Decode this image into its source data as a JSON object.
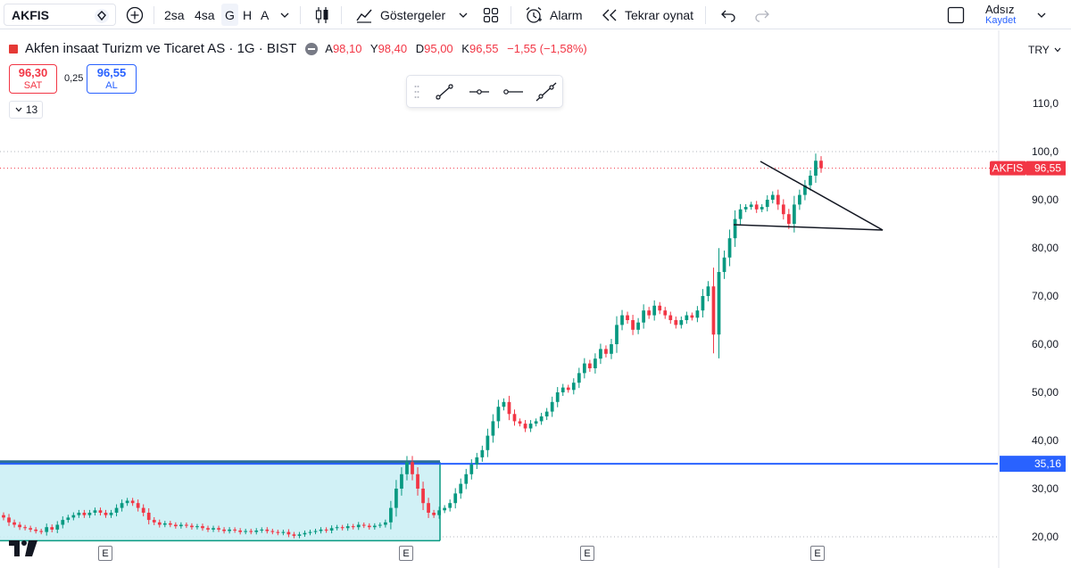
{
  "toolbar": {
    "symbol": "AKFIS",
    "timeframes": [
      "2sa",
      "4sa",
      "G",
      "H",
      "A"
    ],
    "active_timeframe": "G",
    "indicators_label": "Göstergeler",
    "alarm_label": "Alarm",
    "replay_label": "Tekrar oynat",
    "user_name": "Adsız",
    "save_label": "Kaydet"
  },
  "legend": {
    "title": "Akfen insaat Turizm ve Ticaret AS · 1G · BIST",
    "open_label": "A",
    "open": "98,10",
    "high_label": "Y",
    "high": "98,40",
    "low_label": "D",
    "low": "95,00",
    "close_label": "K",
    "close": "96,55",
    "change": "−1,55 (−1,58%)"
  },
  "trade": {
    "sell_price": "96,30",
    "sell_label": "SAT",
    "spread": "0,25",
    "buy_price": "96,55",
    "buy_label": "AL",
    "collapse_count": "13"
  },
  "currency": "TRY",
  "colors": {
    "up": "#089981",
    "down": "#f23645",
    "line": "#2962ff",
    "zone": "#c9eef4"
  },
  "chart_data": {
    "type": "candlestick",
    "price_scale": [
      "110,0",
      "100,0",
      "90,00",
      "80,00",
      "70,00",
      "60,00",
      "50,00",
      "40,00",
      "30,00",
      "20,00"
    ],
    "price_scale_values": [
      110,
      100,
      90,
      80,
      70,
      60,
      50,
      40,
      30,
      20
    ],
    "y_range": [
      17,
      118
    ],
    "last_price_label": {
      "symbol": "AKFIS",
      "value": "96,55",
      "price": 96.55
    },
    "horizontal_line": {
      "label": "35,16",
      "price": 35.16
    },
    "earnings_markers": [
      "E",
      "E",
      "E",
      "E"
    ],
    "triangle": {
      "note": "symmetrical triangle drawing near the highs"
    },
    "closes": [
      24,
      23,
      22.5,
      22,
      21.8,
      21.5,
      21.2,
      21,
      22,
      21.5,
      22.5,
      23.5,
      24,
      24.5,
      25,
      24.5,
      25,
      25.5,
      25,
      24.5,
      25,
      26,
      27,
      27.5,
      27,
      26,
      25,
      23.5,
      23,
      22.5,
      22.8,
      22.5,
      22.2,
      22.5,
      22.3,
      22,
      22.2,
      21.8,
      21.5,
      21.8,
      21.5,
      21.2,
      21.5,
      21.3,
      21,
      21.2,
      21,
      21.3,
      21.5,
      21.2,
      21,
      20.8,
      21,
      20.5,
      20.2,
      20.5,
      20.8,
      21,
      21.2,
      21.5,
      21.3,
      21.8,
      22,
      21.8,
      22.2,
      22,
      22.5,
      22.3,
      22,
      22.3,
      22.5,
      23,
      26,
      30,
      33,
      35.5,
      33,
      30,
      27,
      25,
      24.5,
      25.5,
      26,
      27,
      29,
      31,
      33,
      35,
      36.5,
      38,
      41,
      44,
      47,
      48,
      45.5,
      44,
      43.5,
      42.5,
      43.5,
      44,
      45,
      46,
      48,
      50,
      51,
      50.5,
      52,
      54,
      56,
      55,
      57,
      59,
      58,
      60,
      64,
      66,
      65,
      63,
      64.5,
      67,
      66,
      68,
      67,
      66,
      65,
      64,
      65,
      66,
      65.5,
      67,
      70,
      72,
      62,
      75,
      78,
      82,
      86,
      88,
      88.5,
      89,
      88,
      88.5,
      90,
      91,
      89,
      87,
      85,
      89,
      91,
      93,
      95,
      98.1,
      96.55
    ],
    "zone": {
      "top": 35.5,
      "bottom": 19.2
    }
  }
}
